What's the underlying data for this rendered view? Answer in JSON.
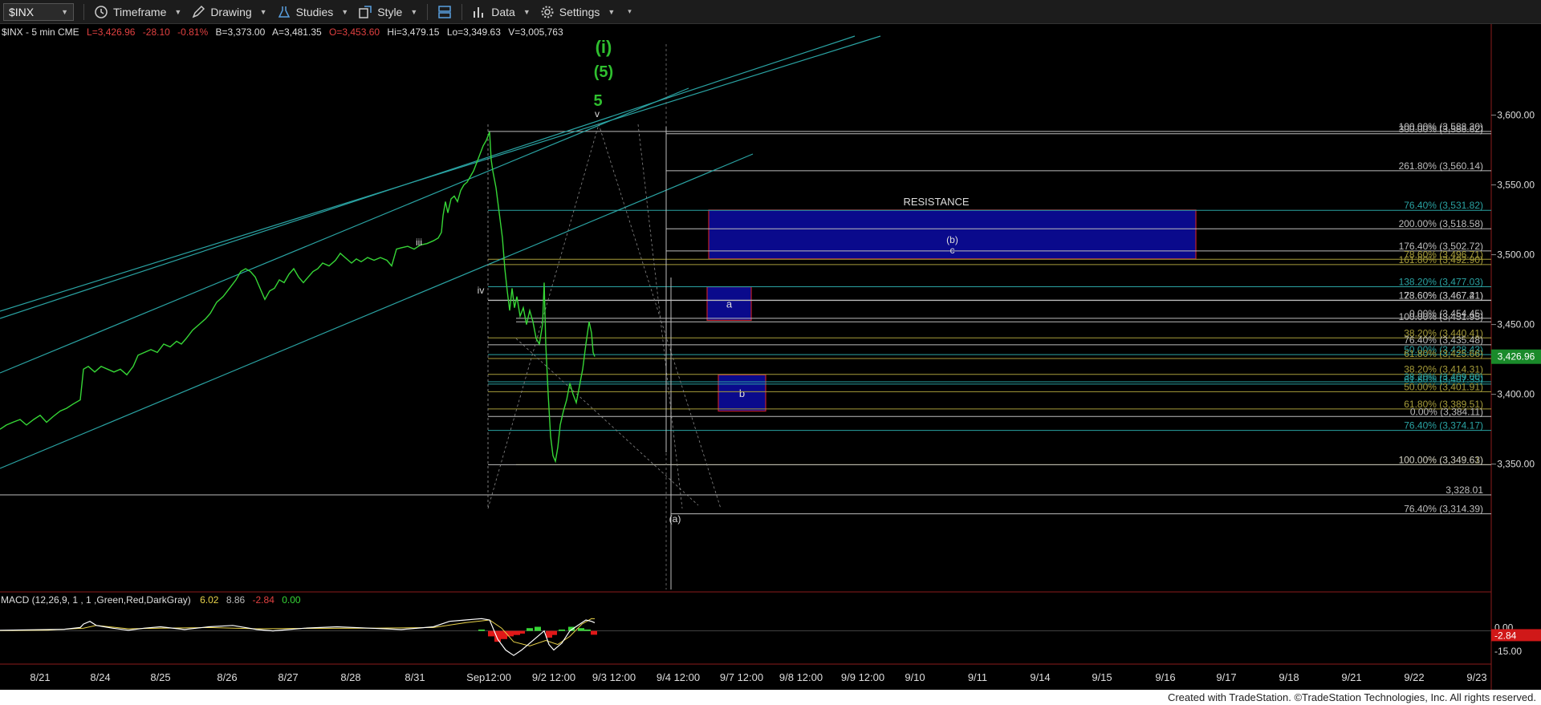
{
  "toolbar": {
    "symbol": "$INX",
    "timeframe": "Timeframe",
    "drawing": "Drawing",
    "studies": "Studies",
    "style": "Style",
    "data": "Data",
    "settings": "Settings"
  },
  "chart_data": {
    "type": "line",
    "header": {
      "symbol": "$INX - 5 min  CME",
      "last": "L=3,426.96",
      "change": "-28.10",
      "change_pct": "-0.81%",
      "bid": "B=3,373.00",
      "ask": "A=3,481.35",
      "open": "O=3,453.60",
      "high": "Hi=3,479.15",
      "low": "Lo=3,349.63",
      "volume": "V=3,005,763"
    },
    "y_ticks": [
      "3,600.00",
      "3,550.00",
      "3,500.00",
      "3,450.00",
      "3,400.00",
      "3,350.00"
    ],
    "ylim": [
      3305,
      3625
    ],
    "last_price_label": "3,426.96",
    "x_ticks": [
      "8/21",
      "8/24",
      "8/25",
      "8/26",
      "8/27",
      "8/28",
      "8/31",
      "Sep12:00",
      "9/2 12:00",
      "9/3 12:00",
      "9/4 12:00",
      "9/7 12:00",
      "9/8 12:00",
      "9/9 12:00",
      "9/10",
      "9/11",
      "9/14",
      "9/15",
      "9/16",
      "9/17",
      "9/18",
      "9/21",
      "9/22",
      "9/23"
    ],
    "price_series": [
      [
        0,
        3375
      ],
      [
        8,
        3378
      ],
      [
        16,
        3380
      ],
      [
        25,
        3382
      ],
      [
        33,
        3378
      ],
      [
        42,
        3382
      ],
      [
        50,
        3385
      ],
      [
        58,
        3380
      ],
      [
        66,
        3384
      ],
      [
        75,
        3388
      ],
      [
        83,
        3390
      ],
      [
        91,
        3393
      ],
      [
        100,
        3396
      ],
      [
        104,
        3418
      ],
      [
        110,
        3420
      ],
      [
        118,
        3416
      ],
      [
        126,
        3420
      ],
      [
        134,
        3418
      ],
      [
        142,
        3416
      ],
      [
        150,
        3418
      ],
      [
        158,
        3414
      ],
      [
        166,
        3420
      ],
      [
        172,
        3428
      ],
      [
        180,
        3430
      ],
      [
        188,
        3432
      ],
      [
        196,
        3430
      ],
      [
        204,
        3436
      ],
      [
        212,
        3434
      ],
      [
        220,
        3438
      ],
      [
        226,
        3436
      ],
      [
        232,
        3440
      ],
      [
        240,
        3446
      ],
      [
        248,
        3450
      ],
      [
        256,
        3454
      ],
      [
        262,
        3458
      ],
      [
        270,
        3466
      ],
      [
        278,
        3470
      ],
      [
        286,
        3476
      ],
      [
        294,
        3482
      ],
      [
        300,
        3488
      ],
      [
        306,
        3490
      ],
      [
        312,
        3488
      ],
      [
        318,
        3484
      ],
      [
        324,
        3476
      ],
      [
        330,
        3468
      ],
      [
        336,
        3474
      ],
      [
        342,
        3476
      ],
      [
        348,
        3482
      ],
      [
        354,
        3480
      ],
      [
        360,
        3486
      ],
      [
        366,
        3490
      ],
      [
        372,
        3484
      ],
      [
        378,
        3480
      ],
      [
        384,
        3484
      ],
      [
        390,
        3488
      ],
      [
        396,
        3490
      ],
      [
        402,
        3494
      ],
      [
        410,
        3492
      ],
      [
        418,
        3496
      ],
      [
        424,
        3501
      ],
      [
        430,
        3498
      ],
      [
        438,
        3494
      ],
      [
        444,
        3497
      ],
      [
        450,
        3495
      ],
      [
        458,
        3498
      ],
      [
        466,
        3496
      ],
      [
        474,
        3498
      ],
      [
        482,
        3496
      ],
      [
        488,
        3492
      ],
      [
        494,
        3504
      ],
      [
        500,
        3505
      ],
      [
        508,
        3506
      ],
      [
        516,
        3504
      ],
      [
        524,
        3507
      ],
      [
        532,
        3508
      ],
      [
        540,
        3510
      ],
      [
        546,
        3512
      ],
      [
        550,
        3516
      ],
      [
        552,
        3528
      ],
      [
        555,
        3538
      ],
      [
        558,
        3530
      ],
      [
        562,
        3540
      ],
      [
        566,
        3542
      ],
      [
        570,
        3538
      ],
      [
        574,
        3546
      ],
      [
        578,
        3550
      ],
      [
        582,
        3552
      ],
      [
        586,
        3556
      ],
      [
        590,
        3560
      ],
      [
        594,
        3566
      ],
      [
        598,
        3572
      ],
      [
        602,
        3578
      ],
      [
        606,
        3582
      ],
      [
        610,
        3588
      ],
      [
        612,
        3568
      ],
      [
        614,
        3560
      ],
      [
        618,
        3548
      ],
      [
        622,
        3530
      ],
      [
        626,
        3512
      ],
      [
        629,
        3490
      ],
      [
        632,
        3474
      ],
      [
        635,
        3460
      ],
      [
        638,
        3476
      ],
      [
        641,
        3462
      ],
      [
        644,
        3470
      ],
      [
        648,
        3456
      ],
      [
        652,
        3462
      ],
      [
        656,
        3450
      ],
      [
        660,
        3460
      ],
      [
        664,
        3452
      ],
      [
        668,
        3440
      ],
      [
        672,
        3436
      ],
      [
        676,
        3450
      ],
      [
        678,
        3480
      ],
      [
        680,
        3436
      ],
      [
        683,
        3400
      ],
      [
        686,
        3370
      ],
      [
        689,
        3356
      ],
      [
        692,
        3352
      ],
      [
        695,
        3362
      ],
      [
        698,
        3378
      ],
      [
        702,
        3388
      ],
      [
        706,
        3396
      ],
      [
        710,
        3408
      ],
      [
        714,
        3400
      ],
      [
        718,
        3394
      ],
      [
        722,
        3406
      ],
      [
        726,
        3418
      ],
      [
        730,
        3436
      ],
      [
        734,
        3452
      ],
      [
        737,
        3444
      ],
      [
        739,
        3430
      ],
      [
        741,
        3427
      ]
    ],
    "fib_levels": [
      {
        "label": "100.00% (3,588.30)",
        "value": 3588.3,
        "color": "#bdbdbd"
      },
      {
        "label": "300.00% (3,586.62)",
        "value": 3586.62,
        "color": "#bdbdbd"
      },
      {
        "label": "261.80% (3,560.14)",
        "value": 3560.14,
        "color": "#bdbdbd"
      },
      {
        "label": "76.40% (3,531.82)",
        "value": 3531.82,
        "color": "#2aa3a3"
      },
      {
        "label": "200.00% (3,518.58)",
        "value": 3518.58,
        "color": "#bdbdbd"
      },
      {
        "label": "176.40% (3,502.72)",
        "value": 3502.72,
        "color": "#bdbdbd"
      },
      {
        "label": "78.60% (3,496.71)",
        "value": 3496.71,
        "color": "#a79d3a"
      },
      {
        "label": "161.80% (3,492.90)",
        "value": 3492.9,
        "color": "#a79d3a"
      },
      {
        "label": "138.20% (3,477.03)",
        "value": 3477.03,
        "color": "#2aa3a3"
      },
      {
        "label": "78.60% (3,467.41)",
        "value": 3467.41,
        "color": "#bdbdbd"
      },
      {
        "label": "123.60% (3,467.21)",
        "value": 3467.21,
        "color": "#bdbdbd"
      },
      {
        "label": "0.00% (3,454.45)",
        "value": 3454.45,
        "color": "#bdbdbd"
      },
      {
        "label": "100.00% (3,451.95)",
        "value": 3451.95,
        "color": "#bdbdbd"
      },
      {
        "label": "38.20% (3,440.41)",
        "value": 3440.41,
        "color": "#a79d3a"
      },
      {
        "label": "76.40% (3,435.48)",
        "value": 3435.48,
        "color": "#bdbdbd"
      },
      {
        "label": "50.00% (3,428.43)",
        "value": 3428.43,
        "color": "#2aa3a3"
      },
      {
        "label": "61.80% (3,425.66)",
        "value": 3425.66,
        "color": "#a79d3a"
      },
      {
        "label": "38.20% (3,414.31)",
        "value": 3414.31,
        "color": "#a79d3a"
      },
      {
        "label": "38.20% (3,409.00)",
        "value": 3409.0,
        "color": "#2aa3a3"
      },
      {
        "label": "61.80% (3,407.35)",
        "value": 3407.35,
        "color": "#2aa3a3"
      },
      {
        "label": "50.00% (3,401.91)",
        "value": 3401.91,
        "color": "#a79d3a"
      },
      {
        "label": "61.80% (3,389.51)",
        "value": 3389.51,
        "color": "#a79d3a"
      },
      {
        "label": "0.00% (3,384.11)",
        "value": 3384.11,
        "color": "#bdbdbd"
      },
      {
        "label": "76.40% (3,374.17)",
        "value": 3374.17,
        "color": "#2aa3a3"
      },
      {
        "label": "100.00% (3,349.61)",
        "value": 3349.61,
        "color": "#a79d3a"
      },
      {
        "label": "100.00% (3,349.63)",
        "value": 3349.63,
        "color": "#bdbdbd"
      },
      {
        "label": "3,328.01",
        "value": 3328.01,
        "color": "#bdbdbd"
      },
      {
        "label": "76.40% (3,314.39)",
        "value": 3314.39,
        "color": "#bdbdbd"
      }
    ],
    "zones": [
      {
        "name": "resistance",
        "label": "RESISTANCE",
        "top": 3532,
        "bottom": 3497,
        "sublabels": [
          "(b)",
          "c"
        ]
      },
      {
        "name": "a",
        "label": "a",
        "top": 3477,
        "bottom": 3453,
        "sublabels": []
      },
      {
        "name": "b",
        "label": "b",
        "top": 3414,
        "bottom": 3388,
        "sublabels": []
      }
    ],
    "wave_labels": {
      "top1": "(i)",
      "top2": "(5)",
      "top3": "5",
      "v": "v",
      "iii": "iii",
      "iv": "iv",
      "a_low": "(a)"
    },
    "macd": {
      "header": "MACD (12,26,9, 1 , 1 ,Green,Red,DarkGray)",
      "macd_value": "6.02",
      "signal_value": "8.86",
      "hist_value": "-2.84",
      "zero_value": "0.00",
      "axis_label_top": "0.00",
      "axis_label_mid": "-2.84",
      "axis_label_bottom": "-15.00",
      "ylim": [
        -22,
        18
      ],
      "macd_line": [
        [
          0,
          0.5
        ],
        [
          40,
          0.8
        ],
        [
          80,
          1.2
        ],
        [
          100,
          2.5
        ],
        [
          104,
          5
        ],
        [
          112,
          7
        ],
        [
          120,
          4
        ],
        [
          140,
          2
        ],
        [
          160,
          0.5
        ],
        [
          180,
          2
        ],
        [
          200,
          3
        ],
        [
          230,
          1
        ],
        [
          260,
          3
        ],
        [
          290,
          4
        ],
        [
          320,
          1
        ],
        [
          340,
          0
        ],
        [
          380,
          2
        ],
        [
          420,
          3
        ],
        [
          460,
          2
        ],
        [
          500,
          1
        ],
        [
          540,
          3
        ],
        [
          560,
          7
        ],
        [
          580,
          8
        ],
        [
          600,
          9
        ],
        [
          610,
          8
        ],
        [
          620,
          -6
        ],
        [
          630,
          -14
        ],
        [
          640,
          -18
        ],
        [
          650,
          -14
        ],
        [
          660,
          -9
        ],
        [
          670,
          -4
        ],
        [
          678,
          0
        ],
        [
          684,
          -10
        ],
        [
          690,
          -14
        ],
        [
          700,
          -9
        ],
        [
          710,
          0
        ],
        [
          720,
          4
        ],
        [
          730,
          8
        ],
        [
          737,
          7
        ],
        [
          741,
          6
        ]
      ],
      "signal_line": [
        [
          0,
          0.3
        ],
        [
          60,
          0.6
        ],
        [
          104,
          2
        ],
        [
          120,
          4
        ],
        [
          160,
          1.5
        ],
        [
          200,
          2
        ],
        [
          260,
          2.5
        ],
        [
          320,
          1.5
        ],
        [
          380,
          1.8
        ],
        [
          460,
          2
        ],
        [
          540,
          2.5
        ],
        [
          580,
          6
        ],
        [
          610,
          8
        ],
        [
          625,
          2
        ],
        [
          640,
          -8
        ],
        [
          660,
          -11
        ],
        [
          680,
          -7
        ],
        [
          695,
          -10
        ],
        [
          710,
          -4
        ],
        [
          725,
          5
        ],
        [
          737,
          9
        ],
        [
          741,
          8.86
        ]
      ],
      "histogram": [
        [
          600,
          1
        ],
        [
          612,
          -4
        ],
        [
          620,
          -8
        ],
        [
          628,
          -6
        ],
        [
          636,
          -4
        ],
        [
          644,
          -3
        ],
        [
          650,
          -2
        ],
        [
          660,
          2
        ],
        [
          670,
          3
        ],
        [
          684,
          -5
        ],
        [
          690,
          -3
        ],
        [
          700,
          1
        ],
        [
          712,
          3
        ],
        [
          724,
          2
        ],
        [
          732,
          1
        ],
        [
          740,
          -2.84
        ]
      ]
    }
  },
  "footer": "Created with TradeStation. ©TradeStation Technologies, Inc. All rights reserved."
}
